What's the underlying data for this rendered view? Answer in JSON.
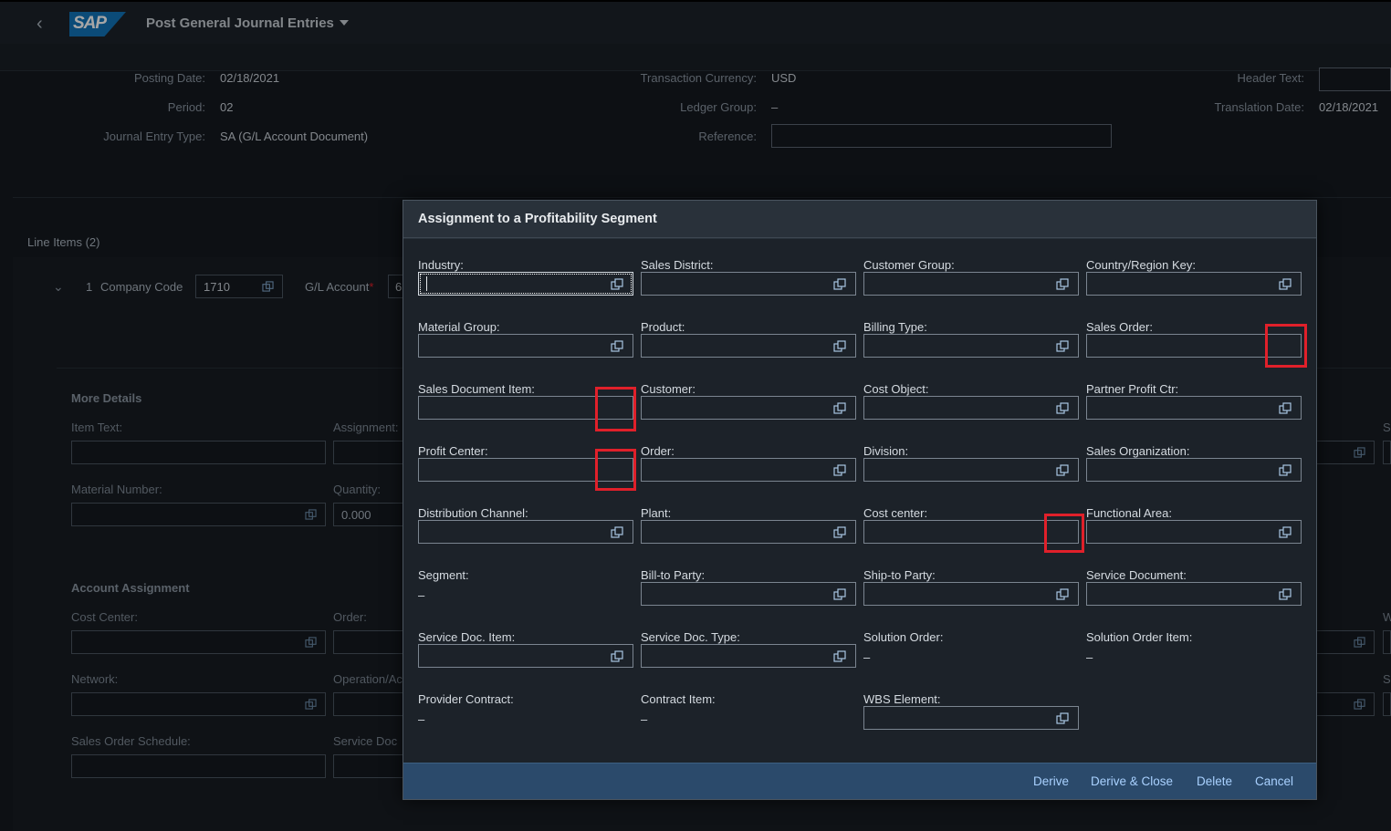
{
  "shell": {
    "logo": "SAP",
    "app_title": "Post General Journal Entries"
  },
  "header": {
    "posting_date_label": "Posting Date:",
    "posting_date": "02/18/2021",
    "period_label": "Period:",
    "period": "02",
    "je_type_label": "Journal Entry Type:",
    "je_type": "SA (G/L Account Document)",
    "currency_label": "Transaction Currency:",
    "currency": "USD",
    "ledger_label": "Ledger Group:",
    "ledger": "–",
    "reference_label": "Reference:",
    "header_text_label": "Header Text:",
    "translation_date_label": "Translation Date:",
    "translation_date": "02/18/2021"
  },
  "line_items": {
    "title": "Line Items (2)",
    "row_no": "1",
    "company_code_label": "Company Code",
    "company_code": "1710",
    "gl_account_label": "G/L Account",
    "gl_account_partial": "6",
    "more_details": "More Details",
    "item_text": "Item Text:",
    "assignment": "Assignment:",
    "material_number": "Material Number:",
    "quantity": "Quantity:",
    "quantity_value": "0.000",
    "account_assignment": "Account Assignment",
    "cost_center": "Cost Center:",
    "order": "Order:",
    "network": "Network:",
    "operation": "Operation/Ac",
    "sales_order_schedule": "Sales Order Schedule:",
    "service_doc": "Service Doc",
    "right_s1": "S",
    "right_w": "W",
    "right_s2": "S"
  },
  "dialog": {
    "title": "Assignment to a Profitability Segment",
    "fields": [
      {
        "label": "Industry:",
        "type": "input"
      },
      {
        "label": "Sales District:",
        "type": "input"
      },
      {
        "label": "Customer Group:",
        "type": "input"
      },
      {
        "label": "Country/Region Key:",
        "type": "input"
      },
      {
        "label": "Material Group:",
        "type": "input"
      },
      {
        "label": "Product:",
        "type": "input"
      },
      {
        "label": "Billing Type:",
        "type": "input"
      },
      {
        "label": "Sales Order:",
        "type": "input"
      },
      {
        "label": "Sales Document Item:",
        "type": "input"
      },
      {
        "label": "Customer:",
        "type": "input"
      },
      {
        "label": "Cost Object:",
        "type": "input"
      },
      {
        "label": "Partner Profit Ctr:",
        "type": "input"
      },
      {
        "label": "Profit Center:",
        "type": "input"
      },
      {
        "label": "Order:",
        "type": "input"
      },
      {
        "label": "Division:",
        "type": "input"
      },
      {
        "label": "Sales Organization:",
        "type": "input"
      },
      {
        "label": "Distribution Channel:",
        "type": "input"
      },
      {
        "label": "Plant:",
        "type": "input"
      },
      {
        "label": "Cost center:",
        "type": "input"
      },
      {
        "label": "Functional Area:",
        "type": "input"
      },
      {
        "label": "Segment:",
        "type": "text",
        "value": "–"
      },
      {
        "label": "Bill-to Party:",
        "type": "input"
      },
      {
        "label": "Ship-to Party:",
        "type": "input"
      },
      {
        "label": "Service Document:",
        "type": "input"
      },
      {
        "label": "Service Doc. Item:",
        "type": "input"
      },
      {
        "label": "Service Doc. Type:",
        "type": "input"
      },
      {
        "label": "Solution Order:",
        "type": "text",
        "value": "–"
      },
      {
        "label": "Solution Order Item:",
        "type": "text",
        "value": "–"
      },
      {
        "label": "Provider Contract:",
        "type": "text",
        "value": "–"
      },
      {
        "label": "Contract Item:",
        "type": "text",
        "value": "–"
      },
      {
        "label": "WBS Element:",
        "type": "input"
      }
    ],
    "buttons": {
      "derive": "Derive",
      "derive_close": "Derive & Close",
      "delete": "Delete",
      "cancel": "Cancel"
    }
  },
  "colors": {
    "highlight": "#e0202a",
    "link": "#a9d1ff",
    "footer": "#2b4a6b"
  }
}
